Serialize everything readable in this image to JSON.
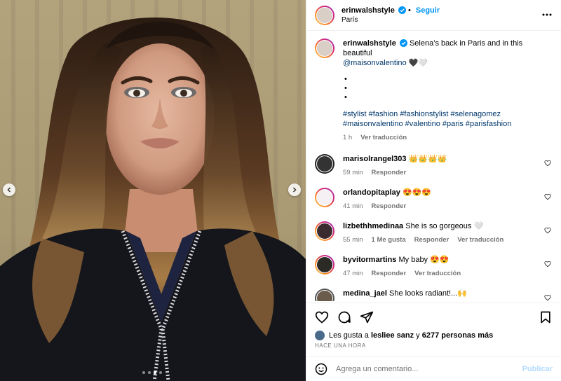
{
  "post": {
    "username": "erinwalshstyle",
    "follow_label": "Seguir",
    "location": "París",
    "caption": {
      "text": "Selena’s back in Paris and in this beautiful",
      "mention": "@maisonvalentino",
      "emoji": "🖤🤍",
      "bullets": [
        "•",
        "•",
        "•"
      ],
      "hashtags_line1": "#stylist #fashion #fashionstylist #selenagomez",
      "hashtags_line2": "#maisonvalentino #valentino #paris #parisfashion",
      "time": "1 h",
      "see_translation": "Ver traducción"
    },
    "comments": [
      {
        "user": "marisolrangel303",
        "text": "👑👑👑👑",
        "time": "59 min",
        "likes": "",
        "reply": "Responder",
        "translate": ""
      },
      {
        "user": "orlandopitaplay",
        "text": "😍😍😍",
        "time": "41 min",
        "likes": "",
        "reply": "Responder",
        "translate": ""
      },
      {
        "user": "lizbethhmedinaa",
        "text": "She is so gorgeous 🤍",
        "time": "55 min",
        "likes": "1 Me gusta",
        "reply": "Responder",
        "translate": "Ver traducción"
      },
      {
        "user": "byvitormartins",
        "text": "My baby 😍😍",
        "time": "47 min",
        "likes": "",
        "reply": "Responder",
        "translate": "Ver traducción"
      },
      {
        "user": "medina_jael",
        "text": "She looks radiant!...🙌",
        "time": "",
        "likes": "",
        "reply": "",
        "translate": ""
      }
    ],
    "likes": {
      "prefix": "Les gusta a",
      "user": "lesliee sanz",
      "conj": "y",
      "count": "6277 personas más"
    },
    "timestamp": "HACE UNA HORA",
    "add_comment_placeholder": "Agrega un comentario...",
    "publish_label": "Publicar",
    "carousel": {
      "slides": 4,
      "active": 3
    }
  }
}
